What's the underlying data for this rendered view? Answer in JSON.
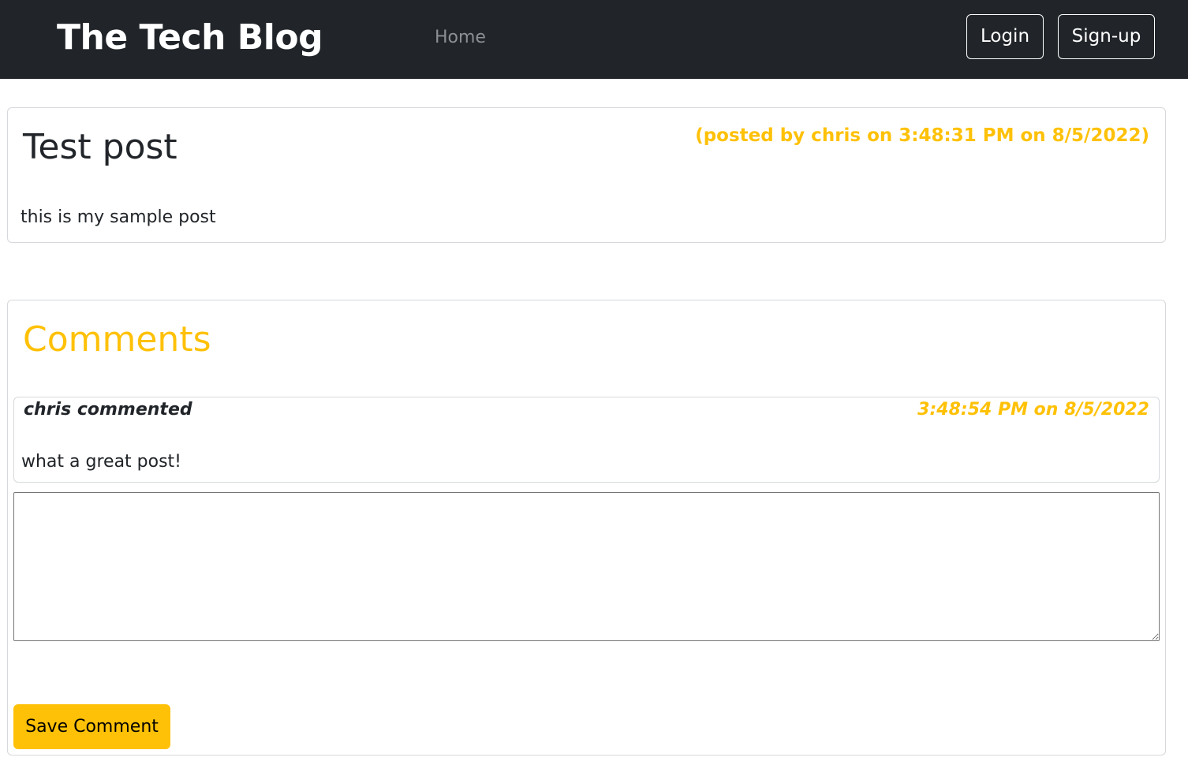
{
  "navbar": {
    "brand": "The Tech Blog",
    "home_link": "Home",
    "login_label": "Login",
    "signup_label": "Sign-up"
  },
  "post": {
    "title": "Test post",
    "meta": "(posted by chris on 3:48:31 PM on 8/5/2022)",
    "body": "this is my sample post"
  },
  "comments": {
    "heading": "Comments",
    "items": [
      {
        "author_line": "chris commented",
        "timestamp": "3:48:54 PM on 8/5/2022",
        "text": "what a great post!"
      }
    ],
    "input": {
      "value": "",
      "placeholder": ""
    },
    "save_label": "Save Comment"
  },
  "colors": {
    "navbar_bg": "#212529",
    "accent": "#ffc107",
    "text": "#212529",
    "muted_link": "#8c8f93",
    "border": "#d6d8db"
  }
}
